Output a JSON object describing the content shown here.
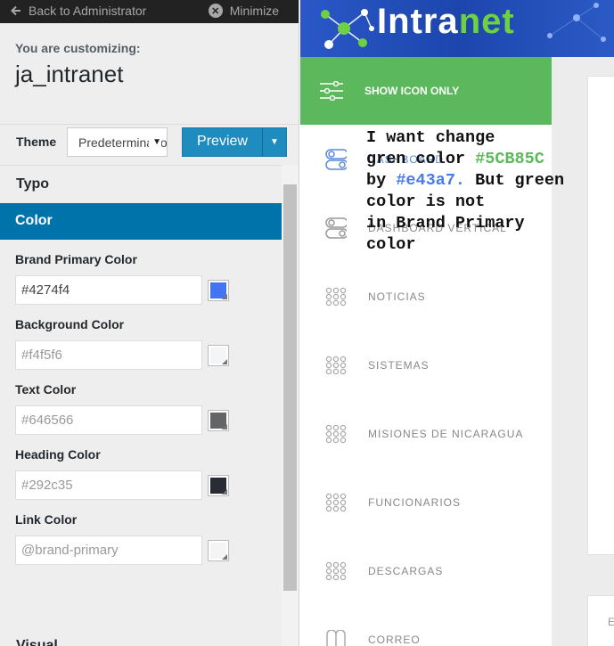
{
  "topbar": {
    "back_label": "Back to Administrator",
    "minimize_label": "Minimize"
  },
  "customizer": {
    "customizing_label": "You are customizing:",
    "site_name": "ja_intranet",
    "theme_label": "Theme",
    "theme_value": "Predeterminado",
    "preview_label": "Preview",
    "sections": {
      "typo": "Typo",
      "color": "Color",
      "visual": "Visual"
    },
    "fields": [
      {
        "label": "Brand Primary Color",
        "value": "#4274f4",
        "swatch": "#4274f4",
        "dim": false
      },
      {
        "label": "Background Color",
        "value": "#f4f5f6",
        "swatch": "#f4f5f6",
        "dim": true
      },
      {
        "label": "Text Color",
        "value": "#646566",
        "swatch": "#646566",
        "dim": true
      },
      {
        "label": "Heading Color",
        "value": "#292c35",
        "swatch": "#292c35",
        "dim": true
      },
      {
        "label": "Link Color",
        "value": "@brand-primary",
        "swatch": "#f4f4f4",
        "dim": true
      }
    ]
  },
  "preview": {
    "logo_a": "Intra",
    "logo_b": "net",
    "sidebar_toggle_label": "SHOW ICON ONLY",
    "nav": [
      {
        "label": "DASHBOARD",
        "icon": "toggle-icon",
        "active": true
      },
      {
        "label": "DASHBOARD VERTICAL",
        "icon": "toggle-icon",
        "active": false
      },
      {
        "label": "NOTICIAS",
        "icon": "grid-icon",
        "active": false
      },
      {
        "label": "SISTEMAS",
        "icon": "grid-icon",
        "active": false
      },
      {
        "label": "MISIONES DE NICARAGUA",
        "icon": "grid-icon",
        "active": false
      },
      {
        "label": "FUNCIONARIOS",
        "icon": "grid-icon",
        "active": false
      },
      {
        "label": "DESCARGAS",
        "icon": "grid-icon",
        "active": false
      },
      {
        "label": "CORREO",
        "icon": "book-icon",
        "active": false
      }
    ],
    "card_letter": "E"
  },
  "note": {
    "line1": "I want change",
    "line2a": "gren color ",
    "line2b": "#5CB85C",
    "line3a": "by ",
    "line3b": "#e43a7.",
    "line3c": " But green",
    "line4": "color is not",
    "line5": "in Brand Primary",
    "line6": "color"
  },
  "colors": {
    "accent": "#0073aa",
    "sidebar_green": "#5cb85c",
    "brand_blue": "#4274f4"
  }
}
